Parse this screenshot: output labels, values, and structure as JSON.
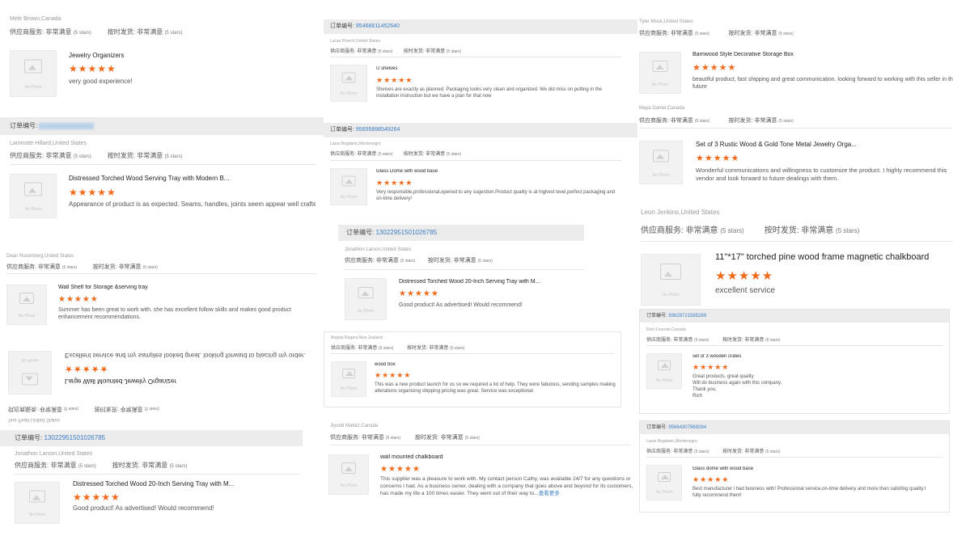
{
  "labels": {
    "order_no": "订单编号:",
    "supplier_service": "供应商服务:",
    "on_time_shipping": "按时发货:",
    "very_satisfied": "非常满意",
    "five_stars": "(5 stars)",
    "no_photo": "No Photo",
    "read_more": "查看更多",
    "stars": "★★★★★"
  },
  "cards": [
    {
      "buyer": "Mele Brown,Canada",
      "product": "Jewelry Organizers",
      "review": "very good experience!"
    },
    {
      "order_no": "",
      "buyer": "Lanmotte Hillard,United States",
      "product": "Distressed Torched Wood Serving Tray with Modern B...",
      "review": "Appearance of product is as expected. Seams, handles, joints seem appear well crafted."
    },
    {
      "buyer": "Dean Rosenberg,United States",
      "product": "Wall Shelf for Storage &serving tray",
      "review": "Summer has been great to work with. she has excellent follow skills and makes good product enhancement recommendations."
    },
    {
      "flipped": true,
      "buyer": "Sue Pearl,United States",
      "product": "Large Wall Mounted Jewelry Organizer",
      "review": "Excellent service and my samples looked great. looking forward to placing my order.",
      "service_rating": "非常满意",
      "stars_text": "(5 stars)"
    },
    {
      "order_no": "13022951501026785",
      "buyer": "Jonathon Larson,United States",
      "product": "Distressed Torched Wood 20-Inch Serving Tray with M...",
      "review": "Good product! As advertised! Would recommend!"
    },
    {
      "order_no": "95468811452640",
      "buyer": "Lucas Preech,United States",
      "product": "U shelves",
      "review": "Shelves are exactly as planned. Packaging looks very clean and organized. We did miss on putting in the installation instruction but we have a plan for that now"
    },
    {
      "order_no": "95655898549264",
      "buyer": "Lazar Bogdanic,Montenegro",
      "product": "Glass Dome with wood base",
      "review": "Very responsible,professional,opened to any sugestion.Product quality is at highest level,perfect packaging and on-time delivery!"
    },
    {
      "order_no": "13022951501026785",
      "buyer": "Jonathon Larson,United States",
      "product": "Distressed Torched Wood 20-Inch Serving Tray with M...",
      "review": "Good product! As advertised! Would recommend!"
    },
    {
      "buyer": "Angela Rogers,New Zealand",
      "product": "wood box",
      "review": "This was a new product launch for us so we required a lot of help. They were fabulous, sending samples making alterations organising shipping pricing was great. Service was exceptional"
    },
    {
      "buyer": "Jiyond Maltez,Canada",
      "product": "wall mounted chalkboard",
      "review": "This supplier was a pleasure to work with. My contact person Cathy, was available 24/7 for any questions or concerns I had. As a business owner, dealing with a company that goes above and beyond for its customers, has made my life a 100 times easier. They went out of their way to..."
    },
    {
      "buyer": "Tyler Mock,United States",
      "product": "Barnwood Style Decorative Storage Box",
      "review": "beautiful product, fast shipping and great communication. looking forward to working with this seller in the future"
    },
    {
      "buyer": "Maya Daniel,Canada",
      "product": "Set of 3 Rustic Wood & Gold Tone Metal Jewelry Orga...",
      "review": "Wonderful communications and willingness to customize the product. I highly recommend this vendor and look forward to future dealings with them."
    },
    {
      "buyer": "Leon Jenkins,United States",
      "product": "11\"*17\" torched pine wood frame magnetic chalkboard",
      "review": "excellent service"
    },
    {
      "order_no": "93628721585289",
      "buyer": "Rich Fournier,Canada",
      "product": "set of 3 wooden crates",
      "review": "Great products, great quality\nWill do business again with this company.\nThank you,\nRich"
    },
    {
      "order_no": "95664307969284",
      "buyer": "Lazar Bogdanic,Montenegro",
      "product": "Glass dome with wood base",
      "review": "Best manufacturer i had business with! Professional service,on-time delivery and more than satisfing quality.I fully recommend them!"
    }
  ]
}
